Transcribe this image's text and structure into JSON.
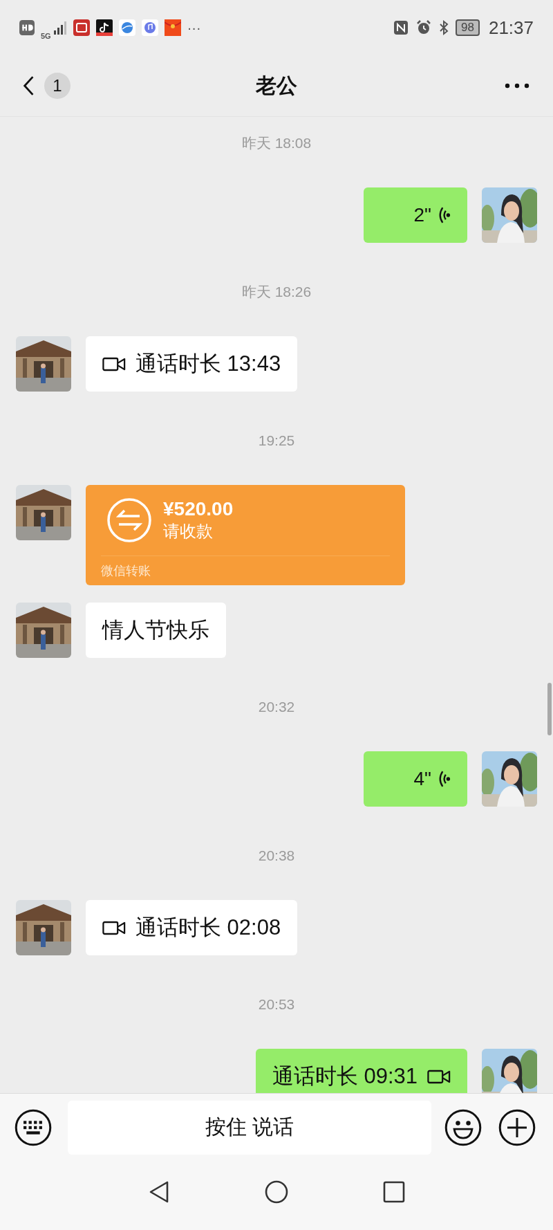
{
  "status_bar": {
    "network": "5G",
    "more": "···",
    "battery": "98",
    "time": "21:37"
  },
  "header": {
    "unread": "1",
    "title": "老公"
  },
  "messages": [
    {
      "kind": "time",
      "text": "昨天 18:08"
    },
    {
      "kind": "voice",
      "outgoing": true,
      "duration": "2\""
    },
    {
      "kind": "time",
      "text": "昨天 18:26"
    },
    {
      "kind": "call",
      "outgoing": false,
      "text": "通话时长 13:43"
    },
    {
      "kind": "time",
      "text": "19:25"
    },
    {
      "kind": "transfer",
      "outgoing": false,
      "amount": "¥520.00",
      "note": "请收款",
      "label": "微信转账"
    },
    {
      "kind": "text",
      "outgoing": false,
      "text": "情人节快乐"
    },
    {
      "kind": "time",
      "text": "20:32"
    },
    {
      "kind": "voice",
      "outgoing": true,
      "duration": "4\""
    },
    {
      "kind": "time",
      "text": "20:38"
    },
    {
      "kind": "call",
      "outgoing": false,
      "text": "通话时长 02:08"
    },
    {
      "kind": "time",
      "text": "20:53"
    },
    {
      "kind": "call",
      "outgoing": true,
      "text": "通话时长 09:31"
    }
  ],
  "input": {
    "hold_to_talk": "按住 说话"
  }
}
